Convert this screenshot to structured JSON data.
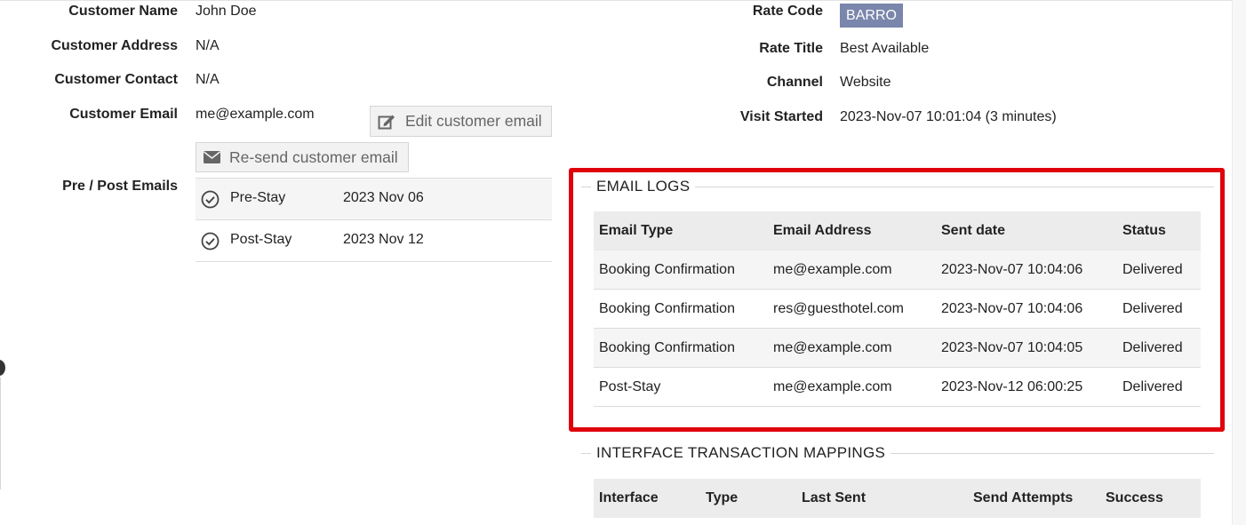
{
  "customer": {
    "name_label": "Customer Name",
    "name_value": "John Doe",
    "address_label": "Customer Address",
    "address_value": "N/A",
    "contact_label": "Customer Contact",
    "contact_value": "N/A",
    "email_label": "Customer Email",
    "email_value": "me@example.com",
    "edit_email_button": "Edit customer email",
    "resend_email_button": "Re-send customer email",
    "prepost_label": "Pre / Post Emails",
    "prepost_rows": [
      {
        "name": "Pre-Stay",
        "date": "2023 Nov 06"
      },
      {
        "name": "Post-Stay",
        "date": "2023 Nov 12"
      }
    ]
  },
  "booking": {
    "rate_code_label": "Rate Code",
    "rate_code_value": "BARRO",
    "rate_title_label": "Rate Title",
    "rate_title_value": "Best Available",
    "channel_label": "Channel",
    "channel_value": "Website",
    "visit_label": "Visit Started",
    "visit_value": "2023-Nov-07 10:01:04 (3 minutes)"
  },
  "email_logs": {
    "title": "EMAIL LOGS",
    "columns": [
      "Email Type",
      "Email Address",
      "Sent date",
      "Status"
    ],
    "rows": [
      [
        "Booking Confirmation",
        "me@example.com",
        "2023-Nov-07 10:04:06",
        "Delivered"
      ],
      [
        "Booking Confirmation",
        "res@guesthotel.com",
        "2023-Nov-07 10:04:06",
        "Delivered"
      ],
      [
        "Booking Confirmation",
        "me@example.com",
        "2023-Nov-07 10:04:05",
        "Delivered"
      ],
      [
        "Post-Stay",
        "me@example.com",
        "2023-Nov-12 06:00:25",
        "Delivered"
      ]
    ]
  },
  "interface_mappings": {
    "title": "INTERFACE TRANSACTION MAPPINGS",
    "columns": [
      "Interface",
      "Type",
      "Last Sent",
      "Send Attempts",
      "Success"
    ]
  },
  "colors": {
    "badge": "#7a86ab",
    "highlight_border": "#e0000a",
    "table_header": "#ececec"
  }
}
